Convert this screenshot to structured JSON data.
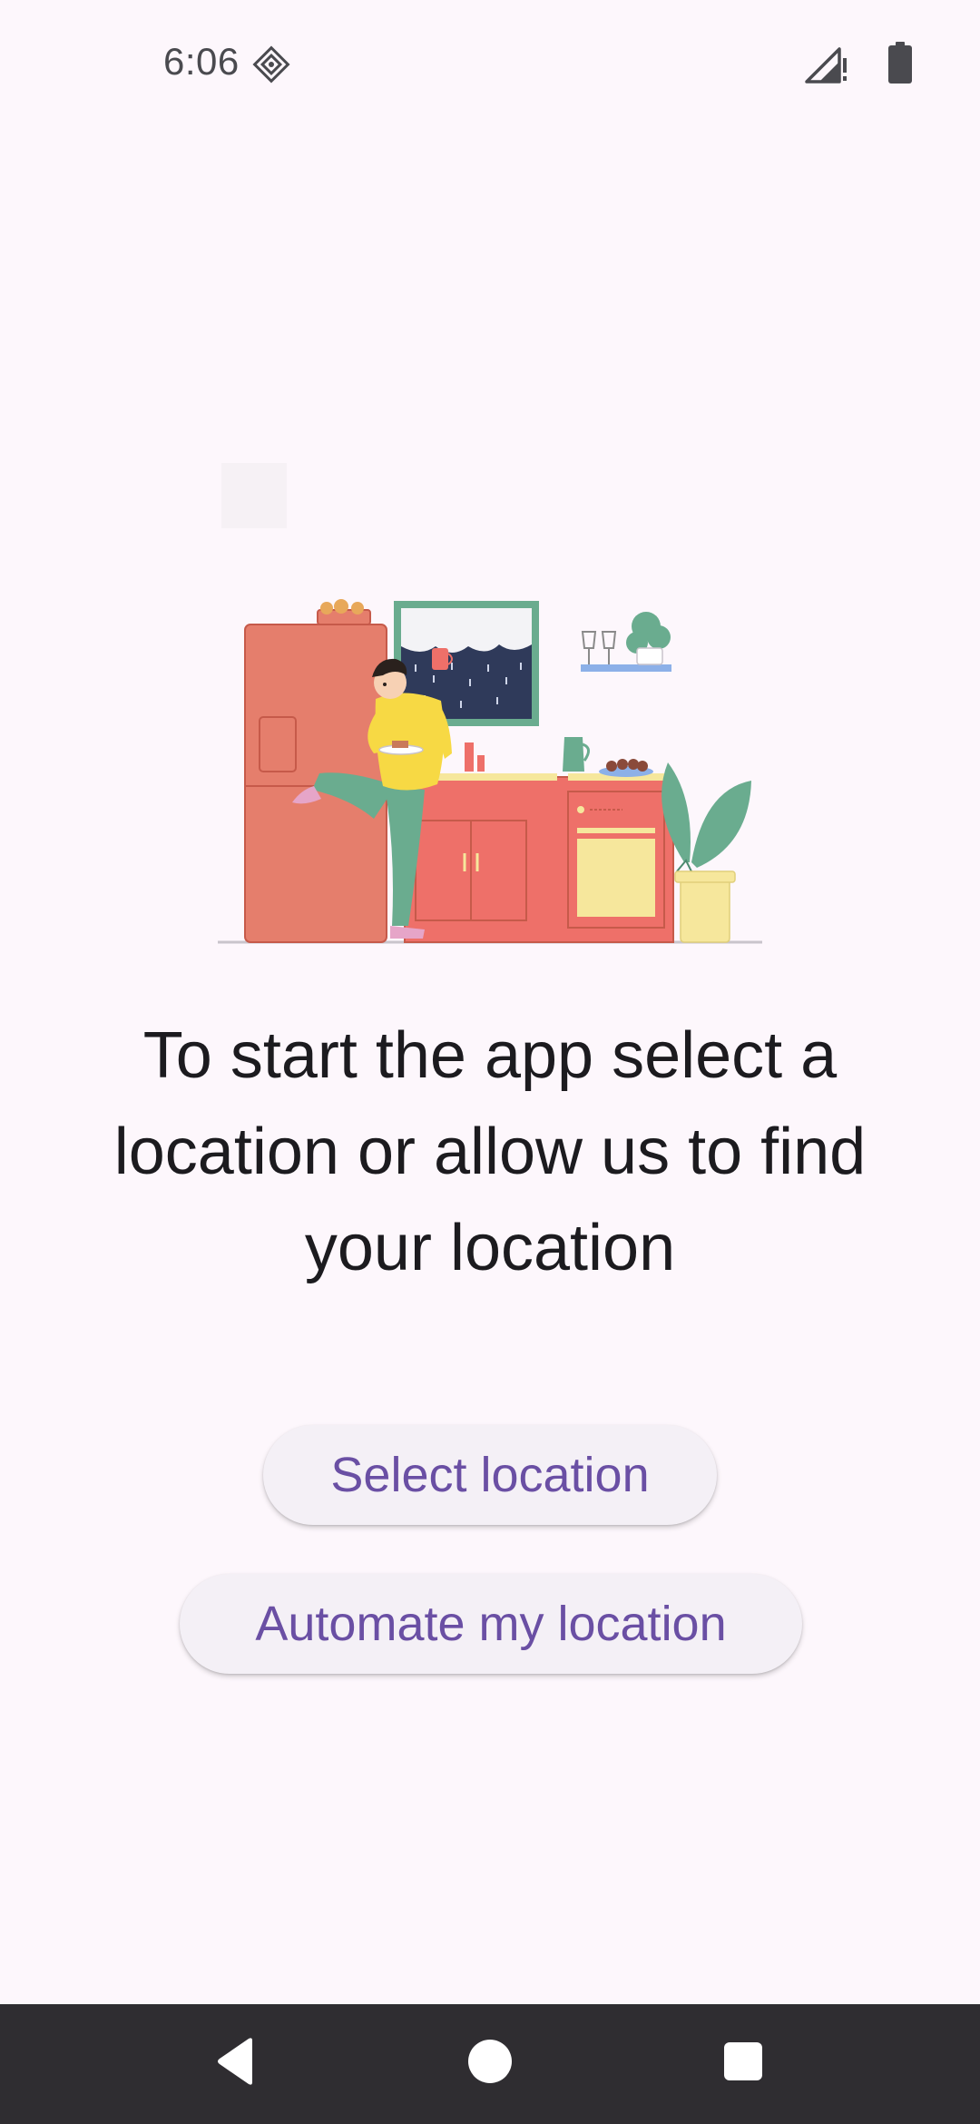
{
  "status_bar": {
    "time": "6:06",
    "left_icon": "data-saver-icon",
    "signal_icon": "signal-no-data-icon",
    "battery_icon": "battery-icon"
  },
  "illustration": {
    "icon": "kitchen-illustration"
  },
  "main": {
    "message": "To start the app select a location or allow us to find your location"
  },
  "buttons": {
    "select_location": "Select location",
    "automate_location": "Automate my location"
  },
  "nav_bar": {
    "back_icon": "back-icon",
    "home_icon": "home-icon",
    "recents_icon": "recents-icon"
  },
  "colors": {
    "background": "#fdf7fc",
    "button_background": "#f4f0f6",
    "button_text": "#6a4fa4",
    "nav_bar": "#2f2d31"
  }
}
